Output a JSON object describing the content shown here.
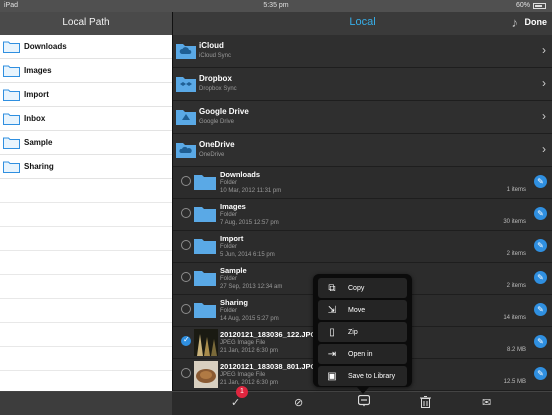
{
  "status": {
    "device": "iPad",
    "time": "5:35 pm",
    "battery": "60%"
  },
  "left": {
    "title": "Local Path",
    "items": [
      {
        "label": "Downloads"
      },
      {
        "label": "Images"
      },
      {
        "label": "Import"
      },
      {
        "label": "Inbox"
      },
      {
        "label": "Sample"
      },
      {
        "label": "Sharing"
      }
    ]
  },
  "right": {
    "title": "Local",
    "done": "Done",
    "clouds": [
      {
        "name": "iCloud",
        "sub": "iCloud Sync",
        "icon": "cloud-folder-icon"
      },
      {
        "name": "Dropbox",
        "sub": "Dropbox Sync",
        "icon": "dropbox-folder-icon"
      },
      {
        "name": "Google Drive",
        "sub": "Google Drive",
        "icon": "google-drive-folder-icon"
      },
      {
        "name": "OneDrive",
        "sub": "OneDrive",
        "icon": "onedrive-folder-icon"
      }
    ],
    "files": [
      {
        "name": "Downloads",
        "type": "Folder",
        "date": "10 Mar, 2012 11:31 pm",
        "count": "1 items",
        "selected": false
      },
      {
        "name": "Images",
        "type": "Folder",
        "date": "7 Aug, 2015 12:57 pm",
        "count": "30 items",
        "selected": false
      },
      {
        "name": "Import",
        "type": "Folder",
        "date": "5 Jun, 2014 6:15 pm",
        "count": "2 items",
        "selected": false
      },
      {
        "name": "Sample",
        "type": "Folder",
        "date": "27 Sep, 2013 12:34 am",
        "count": "2 items",
        "selected": false
      },
      {
        "name": "Sharing",
        "type": "Folder",
        "date": "14 Aug, 2015 5:27 pm",
        "count": "14 items",
        "selected": false
      },
      {
        "name": "20120121_183036_122.JPG",
        "type": "JPEG Image File",
        "date": "21 Jan, 2012 6:30 pm",
        "count": "8.2 MB",
        "selected": true
      },
      {
        "name": "20120121_183038_801.JPG",
        "type": "JPEG Image File",
        "date": "21 Jan, 2012 6:30 pm",
        "count": "12.5 MB",
        "selected": false
      }
    ]
  },
  "menu": {
    "items": [
      {
        "label": "Copy",
        "icon": "copy-icon"
      },
      {
        "label": "Move",
        "icon": "move-icon"
      },
      {
        "label": "Zip",
        "icon": "zip-icon"
      },
      {
        "label": "Open in",
        "icon": "open-in-icon"
      },
      {
        "label": "Save to Library",
        "icon": "save-library-icon"
      }
    ]
  },
  "toolbar": {
    "badge": "1"
  },
  "colors": {
    "accent": "#37aee8",
    "selected": "#2f8fe0",
    "badge": "#e0263f"
  }
}
